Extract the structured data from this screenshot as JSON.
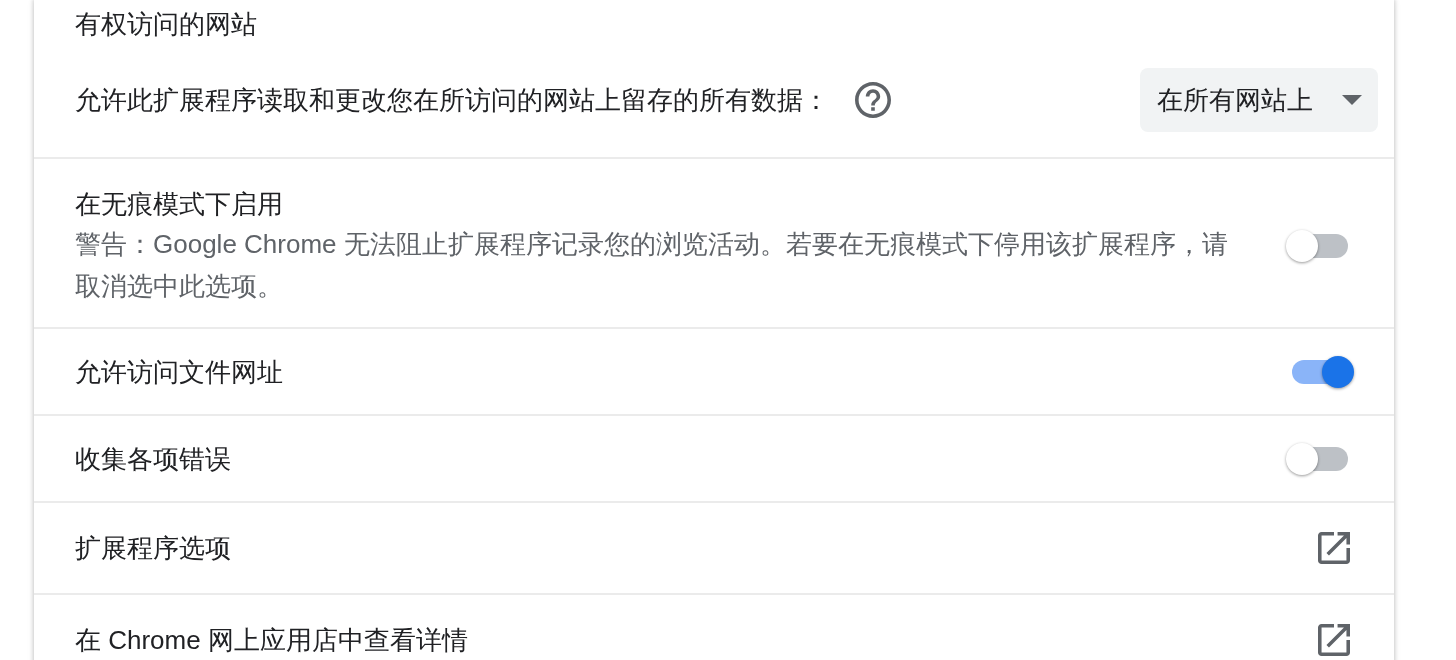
{
  "site_access": {
    "title": "有权访问的网站",
    "description": "允许此扩展程序读取和更改您在所访问的网站上留存的所有数据：",
    "dropdown": {
      "value": "在所有网站上"
    }
  },
  "settings": [
    {
      "kind": "toggle",
      "label": "在无痕模式下启用",
      "description": "警告：Google Chrome 无法阻止扩展程序记录您的浏览活动。若要在无痕模式下停用该扩展程序，请取消选中此选项。",
      "on": false
    },
    {
      "kind": "toggle",
      "label": "允许访问文件网址",
      "on": true
    },
    {
      "kind": "toggle",
      "label": "收集各项错误",
      "on": false
    },
    {
      "kind": "link",
      "label": "扩展程序选项"
    },
    {
      "kind": "link",
      "label": "在 Chrome 网上应用店中查看详情"
    }
  ]
}
